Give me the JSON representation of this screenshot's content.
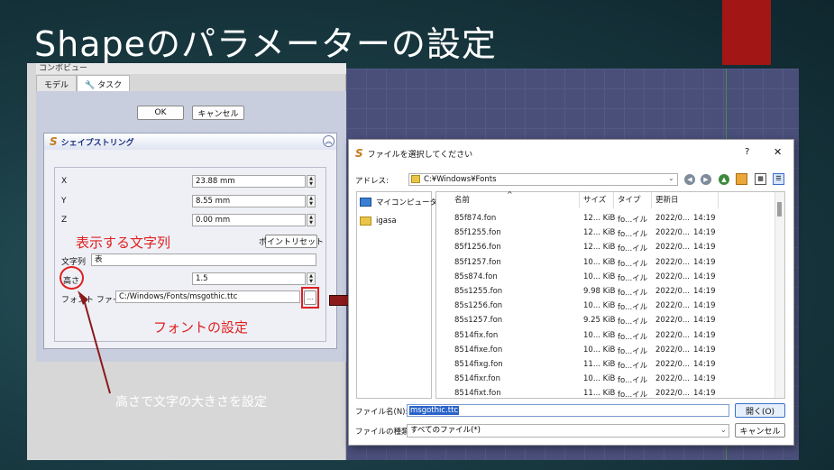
{
  "slide": {
    "title": "Shapeのパラメーターの設定"
  },
  "combo": {
    "header": "コンボビュー",
    "tabs": [
      {
        "label": "モデル"
      },
      {
        "label": "タスク"
      }
    ],
    "ok_label": "OK",
    "cancel_label": "キャンセル",
    "panel_title": "シェイプストリング",
    "fields": {
      "x_label": "X",
      "x_value": "23.88 mm",
      "y_label": "Y",
      "y_value": "8.55 mm",
      "z_label": "Z",
      "z_value": "0.00 mm",
      "point_reset_label": "ポイントリセット",
      "string_label": "文字列",
      "string_value": "表",
      "height_label": "高さ",
      "height_value": "1.5",
      "font_label": "フォント ファイル",
      "font_value": "C:/Windows/Fonts/msgothic.ttc",
      "browse_label": "..."
    }
  },
  "annotations": {
    "display_string": "表示する文字列",
    "font_setting": "フォントの設定",
    "height_note": "高さで文字の大きさを設定"
  },
  "dialog": {
    "title": "ファイルを選択してください",
    "help": "?",
    "close": "✕",
    "address_label": "アドレス:",
    "address_value": "C:¥Windows¥Fonts",
    "sidebar": [
      {
        "label": "マイコンピュータ"
      },
      {
        "label": "igasa"
      }
    ],
    "columns": {
      "name": "名前",
      "size": "サイズ",
      "type": "タイプ",
      "date": "更新日"
    },
    "files": [
      {
        "name": "85f874.fon",
        "size": "12... KiB",
        "type": "fo...イル",
        "date": "2022/0...",
        "time": "14:19"
      },
      {
        "name": "85f1255.fon",
        "size": "12... KiB",
        "type": "fo...イル",
        "date": "2022/0...",
        "time": "14:19"
      },
      {
        "name": "85f1256.fon",
        "size": "12... KiB",
        "type": "fo...イル",
        "date": "2022/0...",
        "time": "14:19"
      },
      {
        "name": "85f1257.fon",
        "size": "10... KiB",
        "type": "fo...イル",
        "date": "2022/0...",
        "time": "14:19"
      },
      {
        "name": "85s874.fon",
        "size": "10... KiB",
        "type": "fo...イル",
        "date": "2022/0...",
        "time": "14:19"
      },
      {
        "name": "85s1255.fon",
        "size": "9.98 KiB",
        "type": "fo...イル",
        "date": "2022/0...",
        "time": "14:19"
      },
      {
        "name": "85s1256.fon",
        "size": "10... KiB",
        "type": "fo...イル",
        "date": "2022/0...",
        "time": "14:19"
      },
      {
        "name": "85s1257.fon",
        "size": "9.25 KiB",
        "type": "fo...イル",
        "date": "2022/0...",
        "time": "14:19"
      },
      {
        "name": "8514fix.fon",
        "size": "10... KiB",
        "type": "fo...イル",
        "date": "2022/0...",
        "time": "14:19"
      },
      {
        "name": "8514fixe.fon",
        "size": "10... KiB",
        "type": "fo...イル",
        "date": "2022/0...",
        "time": "14:19"
      },
      {
        "name": "8514fixg.fon",
        "size": "11... KiB",
        "type": "fo...イル",
        "date": "2022/0...",
        "time": "14:19"
      },
      {
        "name": "8514fixr.fon",
        "size": "10... KiB",
        "type": "fo...イル",
        "date": "2022/0...",
        "time": "14:19"
      },
      {
        "name": "8514fixt.fon",
        "size": "11... KiB",
        "type": "fo...イル",
        "date": "2022/0...",
        "time": "14:19"
      }
    ],
    "filename_label": "ファイル名(N):",
    "filename_value": "msgothic.ttc",
    "open_label": "開く(O)",
    "filetype_label": "ファイルの種類:",
    "filetype_value": "すべてのファイル(*)",
    "cancel_label": "キャンセル"
  },
  "colors": {
    "accent_red": "#e02020",
    "tab_red": "#a31616",
    "arrow": "#8b1a1a"
  }
}
